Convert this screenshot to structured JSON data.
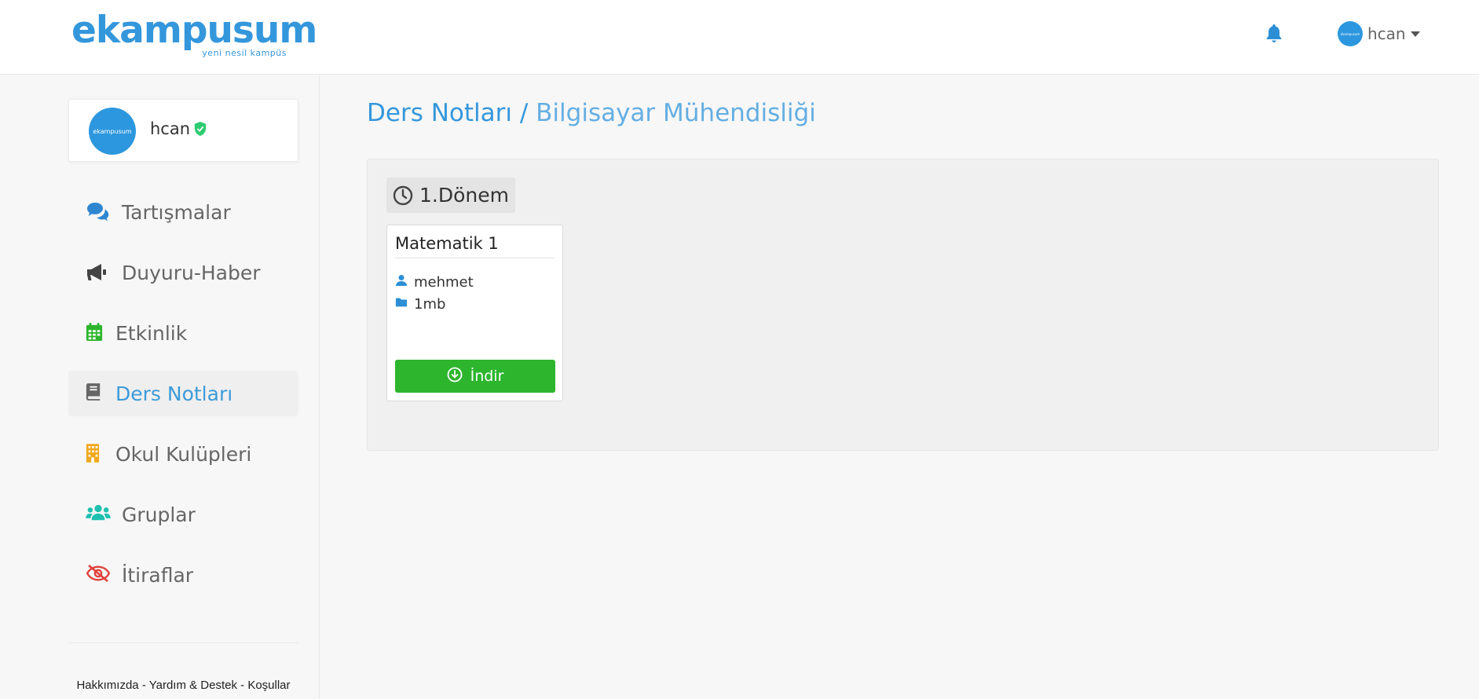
{
  "header": {
    "logo_text": "ekampusum",
    "logo_tagline": "yeni nesil kampüs",
    "avatar_text": "ekampusum",
    "username": "hcan"
  },
  "sidebar": {
    "profile": {
      "avatar_text": "ekampusum",
      "name": "hcan"
    },
    "items": [
      {
        "label": "Tartışmalar",
        "icon": "comments-icon",
        "color": "#2e86d1"
      },
      {
        "label": "Duyuru-Haber",
        "icon": "megaphone-icon",
        "color": "#444444"
      },
      {
        "label": "Etkinlik",
        "icon": "calendar-icon",
        "color": "#2db52d"
      },
      {
        "label": "Ders Notları",
        "icon": "book-icon",
        "color": "#666666",
        "active": true
      },
      {
        "label": "Okul Kulüpleri",
        "icon": "building-icon",
        "color": "#f0a81c"
      },
      {
        "label": "Gruplar",
        "icon": "users-icon",
        "color": "#1fc0b0"
      },
      {
        "label": "İtiraflar",
        "icon": "eye-slash-icon",
        "color": "#e0413b"
      }
    ],
    "footer": {
      "about": "Hakkımızda",
      "sep1": " - ",
      "help": "Yardım & Destek",
      "sep2": " - ",
      "terms": "Koşullar"
    }
  },
  "main": {
    "breadcrumb": {
      "root": "Ders Notları",
      "separator": "/",
      "current": "Bilgisayar Mühendisliği"
    },
    "term": {
      "label": "1.Dönem"
    },
    "notes": [
      {
        "title": "Matematik 1",
        "author": "mehmet",
        "size": "1mb",
        "button_label": "İndir"
      }
    ]
  },
  "colors": {
    "brand": "#3497dc",
    "download": "#2db52d",
    "verified": "#2ecc71"
  }
}
